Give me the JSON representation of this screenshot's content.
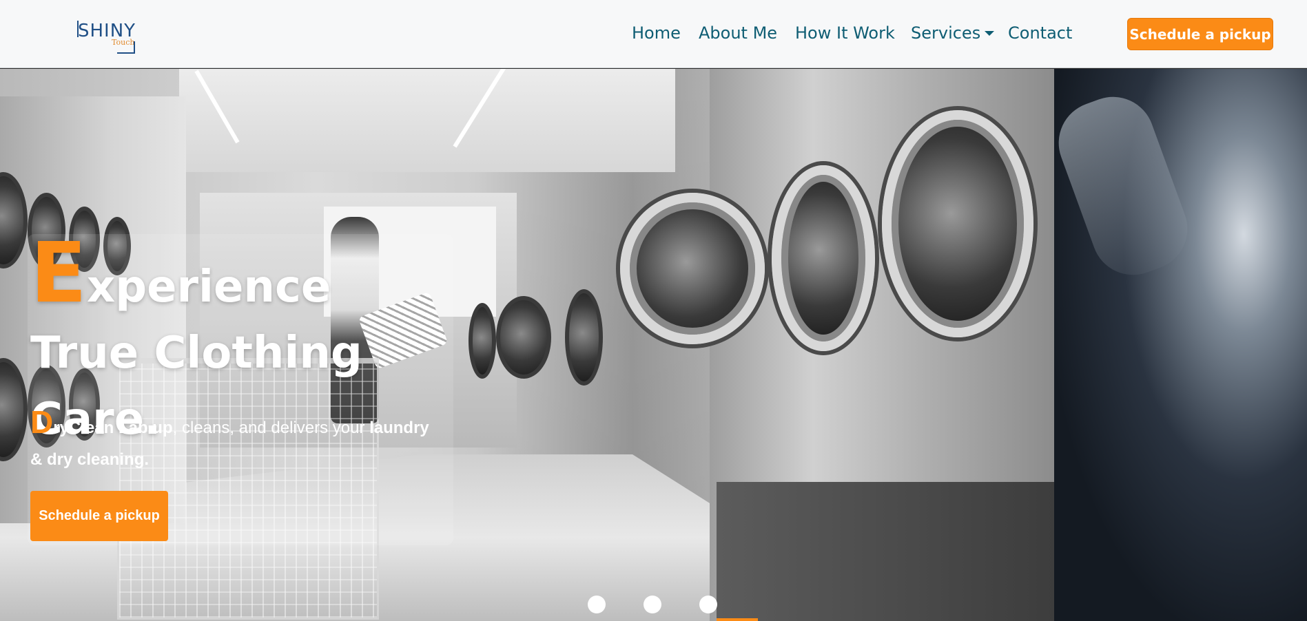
{
  "brand": {
    "logo_main": "SHINY",
    "logo_sub": "Touch",
    "accent_color": "#fb8b16",
    "nav_text_color": "#0e5d73"
  },
  "nav": {
    "items": [
      {
        "label": "Home"
      },
      {
        "label": "About Me"
      },
      {
        "label": "How It Work"
      },
      {
        "label": "Services",
        "has_dropdown": true,
        "icon": "caret-down-icon"
      },
      {
        "label": "Contact"
      }
    ],
    "cta_label": "Schedule a pickup"
  },
  "hero": {
    "heading_dropcap": "E",
    "heading_rest": "xperience True Clothing Care.",
    "sub_dropcap": "D",
    "sub_brand": "ryClean Lab up",
    "sub_middle": ", cleans, and delivers your ",
    "sub_strong": "laundry & dry cleaning.",
    "cta_label": "Schedule a pickup"
  },
  "carousel": {
    "slide_count": 3,
    "active_index": 0
  }
}
